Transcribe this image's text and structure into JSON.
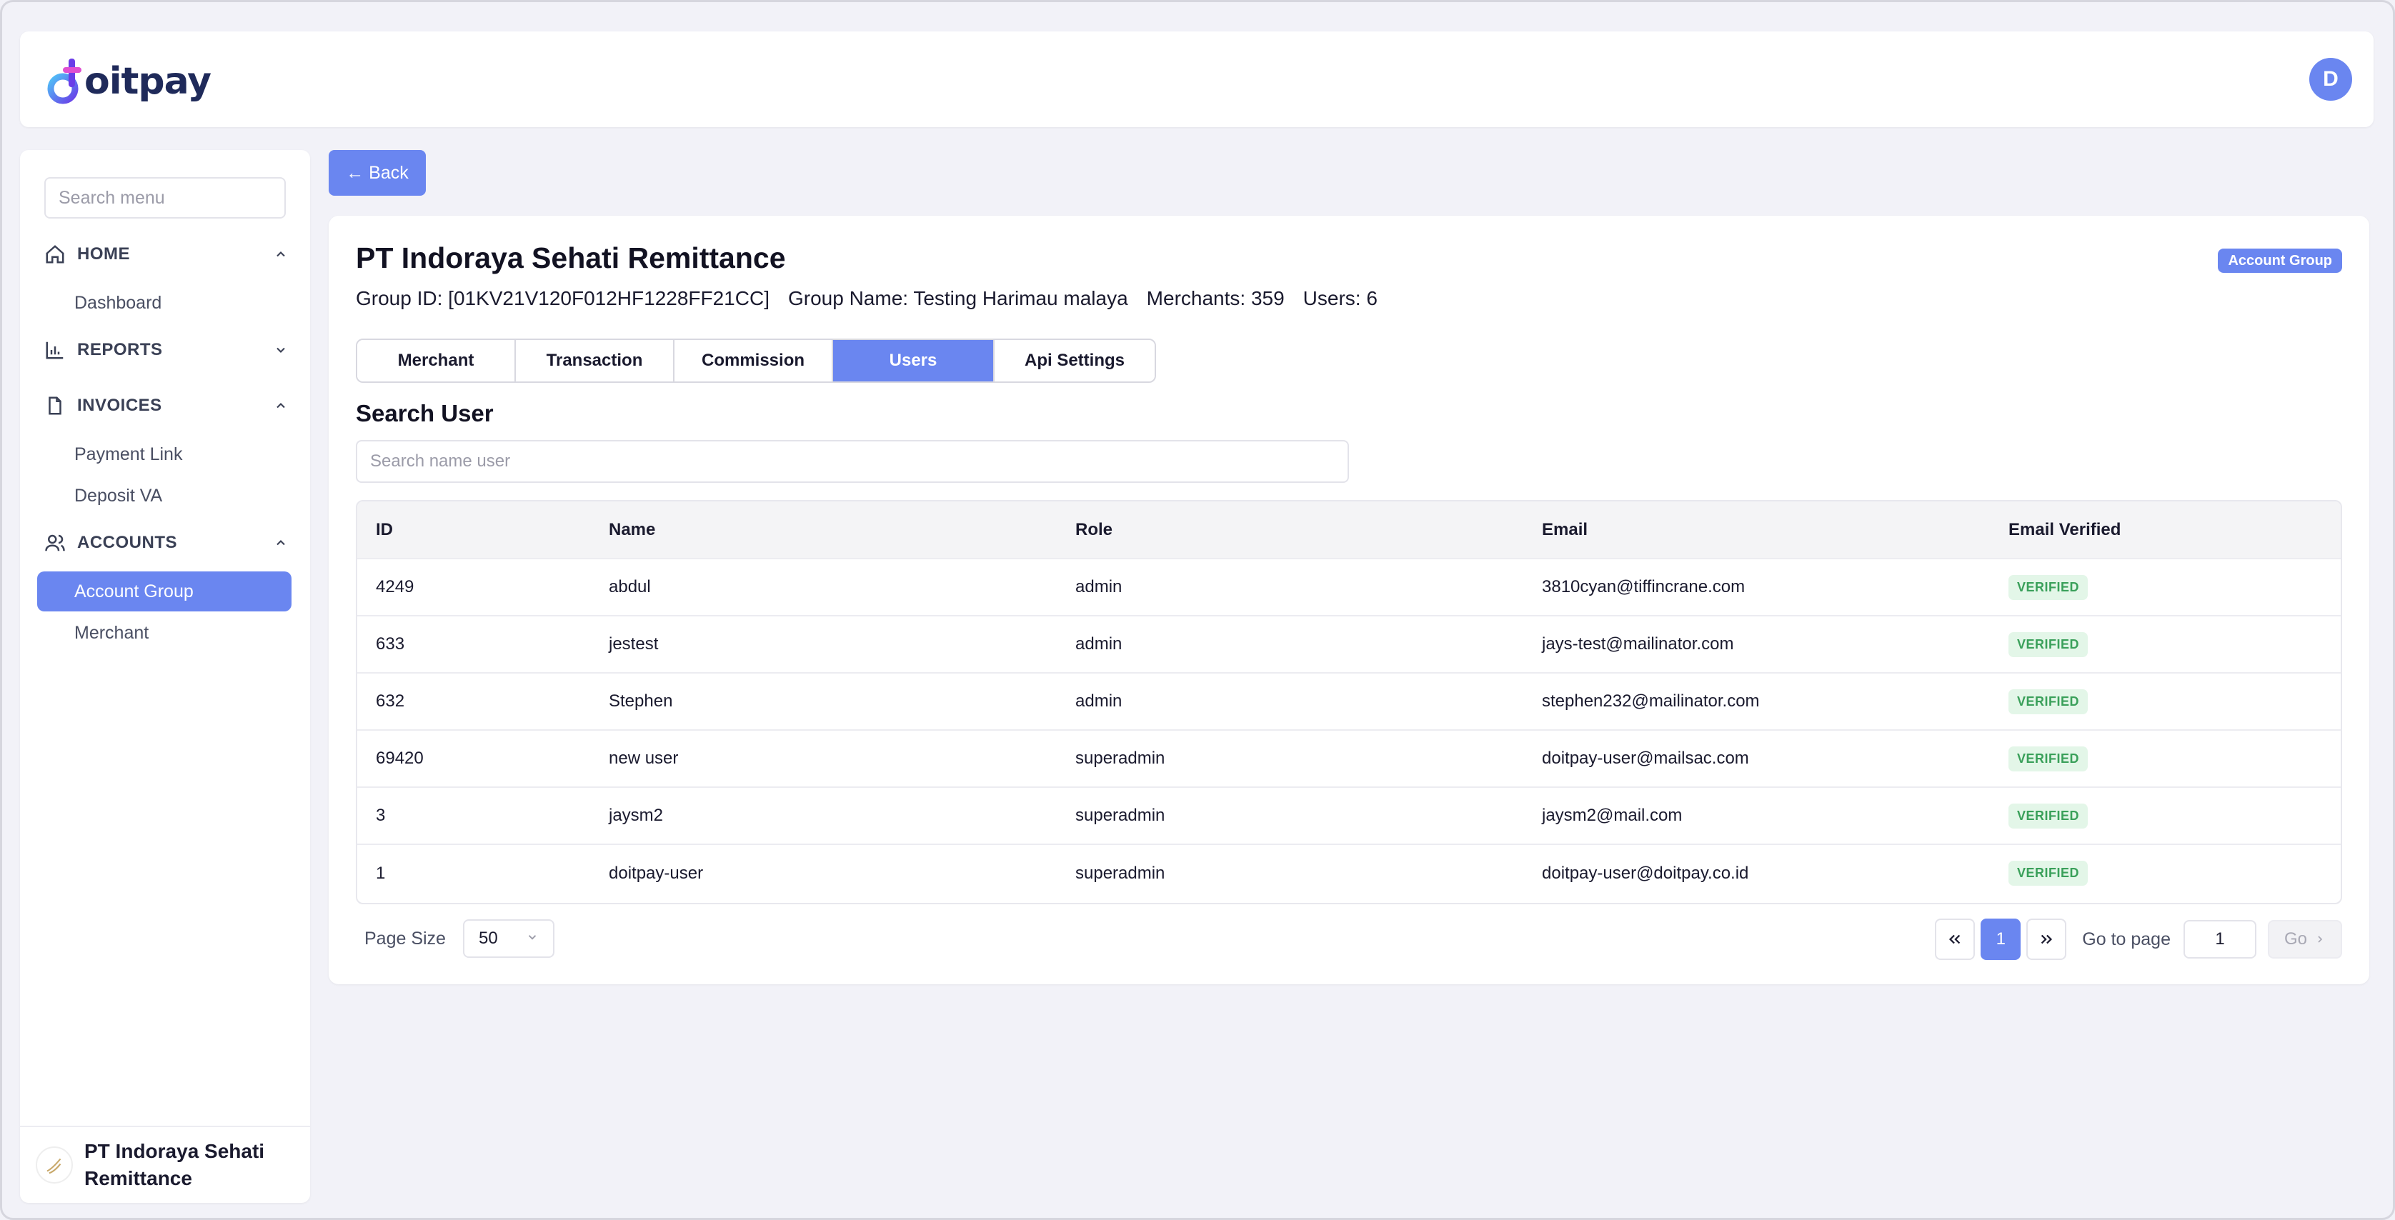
{
  "header": {
    "logo_text": "oitpay",
    "avatar_initial": "D"
  },
  "sidebar": {
    "search_placeholder": "Search menu",
    "sections": [
      {
        "label": "HOME",
        "icon": "home-icon",
        "expanded": true,
        "items": [
          "Dashboard"
        ]
      },
      {
        "label": "REPORTS",
        "icon": "bar-chart-icon",
        "expanded": false,
        "items": []
      },
      {
        "label": "INVOICES",
        "icon": "document-icon",
        "expanded": true,
        "items": [
          "Payment Link",
          "Deposit VA"
        ]
      },
      {
        "label": "ACCOUNTS",
        "icon": "users-icon",
        "expanded": true,
        "items": [
          "Account Group",
          "Merchant"
        ]
      }
    ],
    "active_item": "Account Group",
    "footer_org_name": "PT Indoraya Sehati Remittance"
  },
  "main": {
    "back_label": "← Back",
    "title": "PT Indoraya Sehati Remittance",
    "badge": "Account Group",
    "meta": {
      "group_id": "Group ID: [01KV21V120F012HF1228FF21CC]",
      "group_name": "Group Name: Testing Harimau malaya",
      "merchants": "Merchants: 359",
      "users": "Users: 6"
    },
    "tabs": [
      "Merchant",
      "Transaction",
      "Commission",
      "Users",
      "Api Settings"
    ],
    "active_tab": "Users",
    "search_title": "Search User",
    "search_placeholder": "Search name user",
    "table": {
      "headers": [
        "ID",
        "Name",
        "Role",
        "Email",
        "Email Verified"
      ],
      "rows": [
        [
          "4249",
          "abdul",
          "admin",
          "3810cyan@tiffincrane.com",
          "VERIFIED"
        ],
        [
          "633",
          "jestest",
          "admin",
          "jays-test@mailinator.com",
          "VERIFIED"
        ],
        [
          "632",
          "Stephen",
          "admin",
          "stephen232@mailinator.com",
          "VERIFIED"
        ],
        [
          "69420",
          "new user",
          "superadmin",
          "doitpay-user@mailsac.com",
          "VERIFIED"
        ],
        [
          "3",
          "jaysm2",
          "superadmin",
          "jaysm2@mail.com",
          "VERIFIED"
        ],
        [
          "1",
          "doitpay-user",
          "superadmin",
          "doitpay-user@doitpay.co.id",
          "VERIFIED"
        ]
      ]
    },
    "pagination": {
      "page_size_label": "Page Size",
      "page_size": "50",
      "current_page": "1",
      "goto_label": "Go to page",
      "goto_value": "1",
      "go_label": "Go"
    }
  },
  "colors": {
    "accent": "#6a86f0",
    "verified_bg": "#e3f6e8",
    "verified_text": "#3aa05a"
  }
}
